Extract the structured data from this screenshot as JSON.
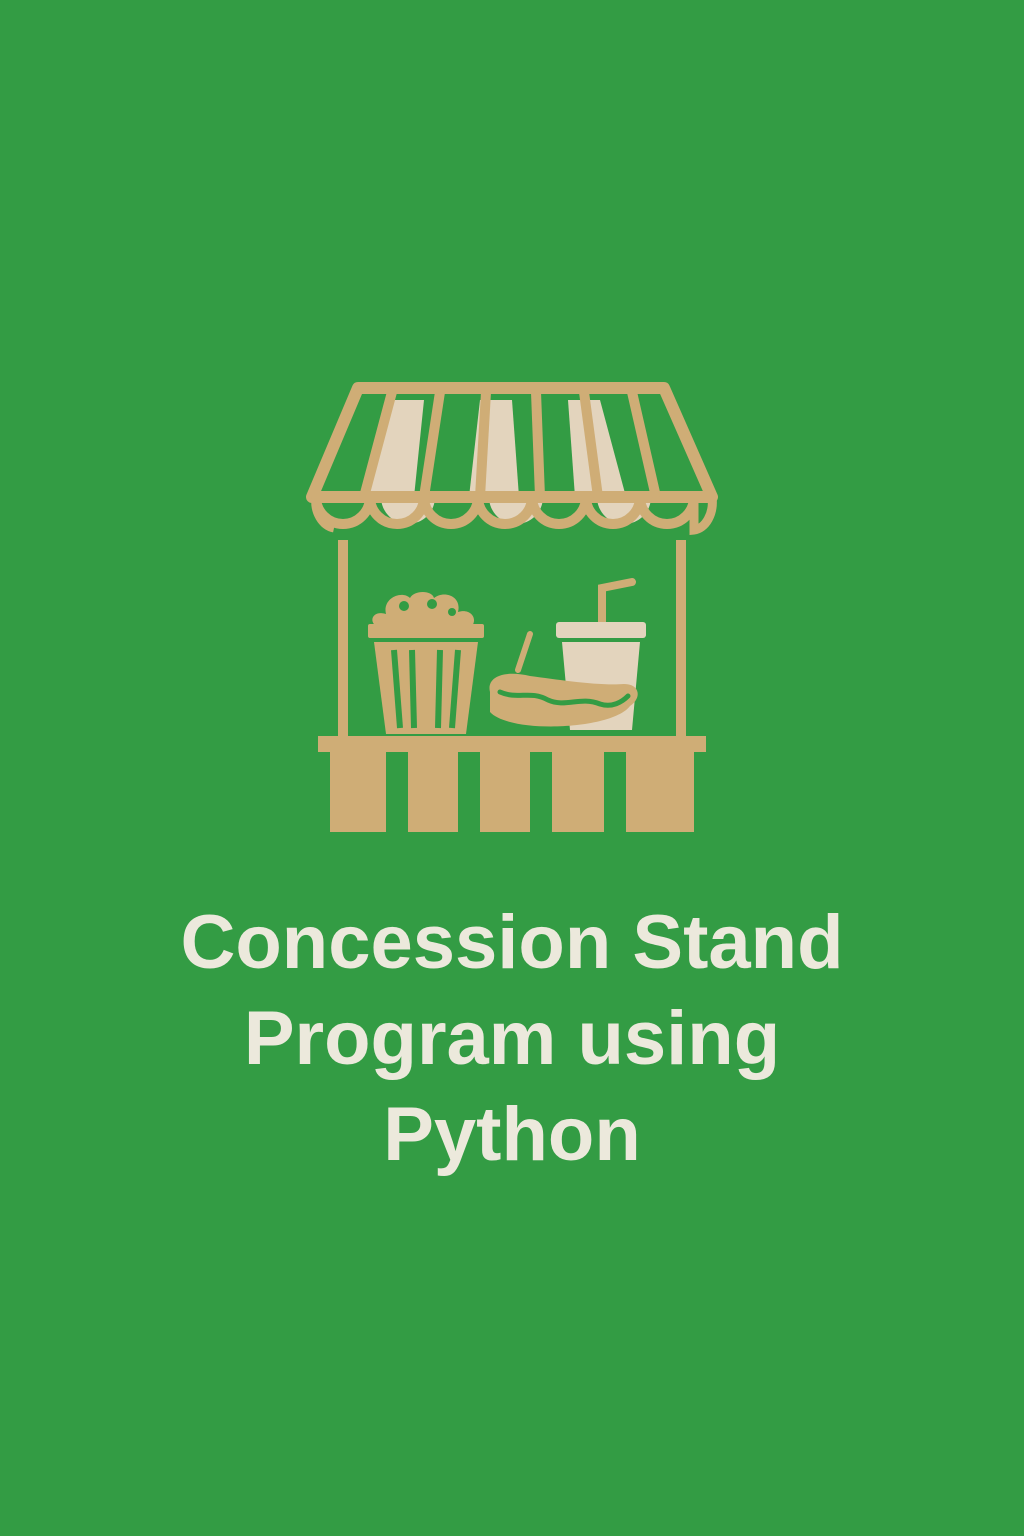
{
  "colors": {
    "background": "#339c44",
    "stand": "#cfad76",
    "stand_light": "#e3d4bd",
    "title_text": "#ece9dc"
  },
  "illustration": {
    "main_icon": "concession-stand-icon",
    "items": [
      "awning-icon",
      "popcorn-bucket-icon",
      "hot-dog-icon",
      "soda-cup-icon",
      "counter-icon"
    ]
  },
  "title": {
    "lines": [
      "Concession Stand",
      "Program using",
      "Python"
    ]
  }
}
